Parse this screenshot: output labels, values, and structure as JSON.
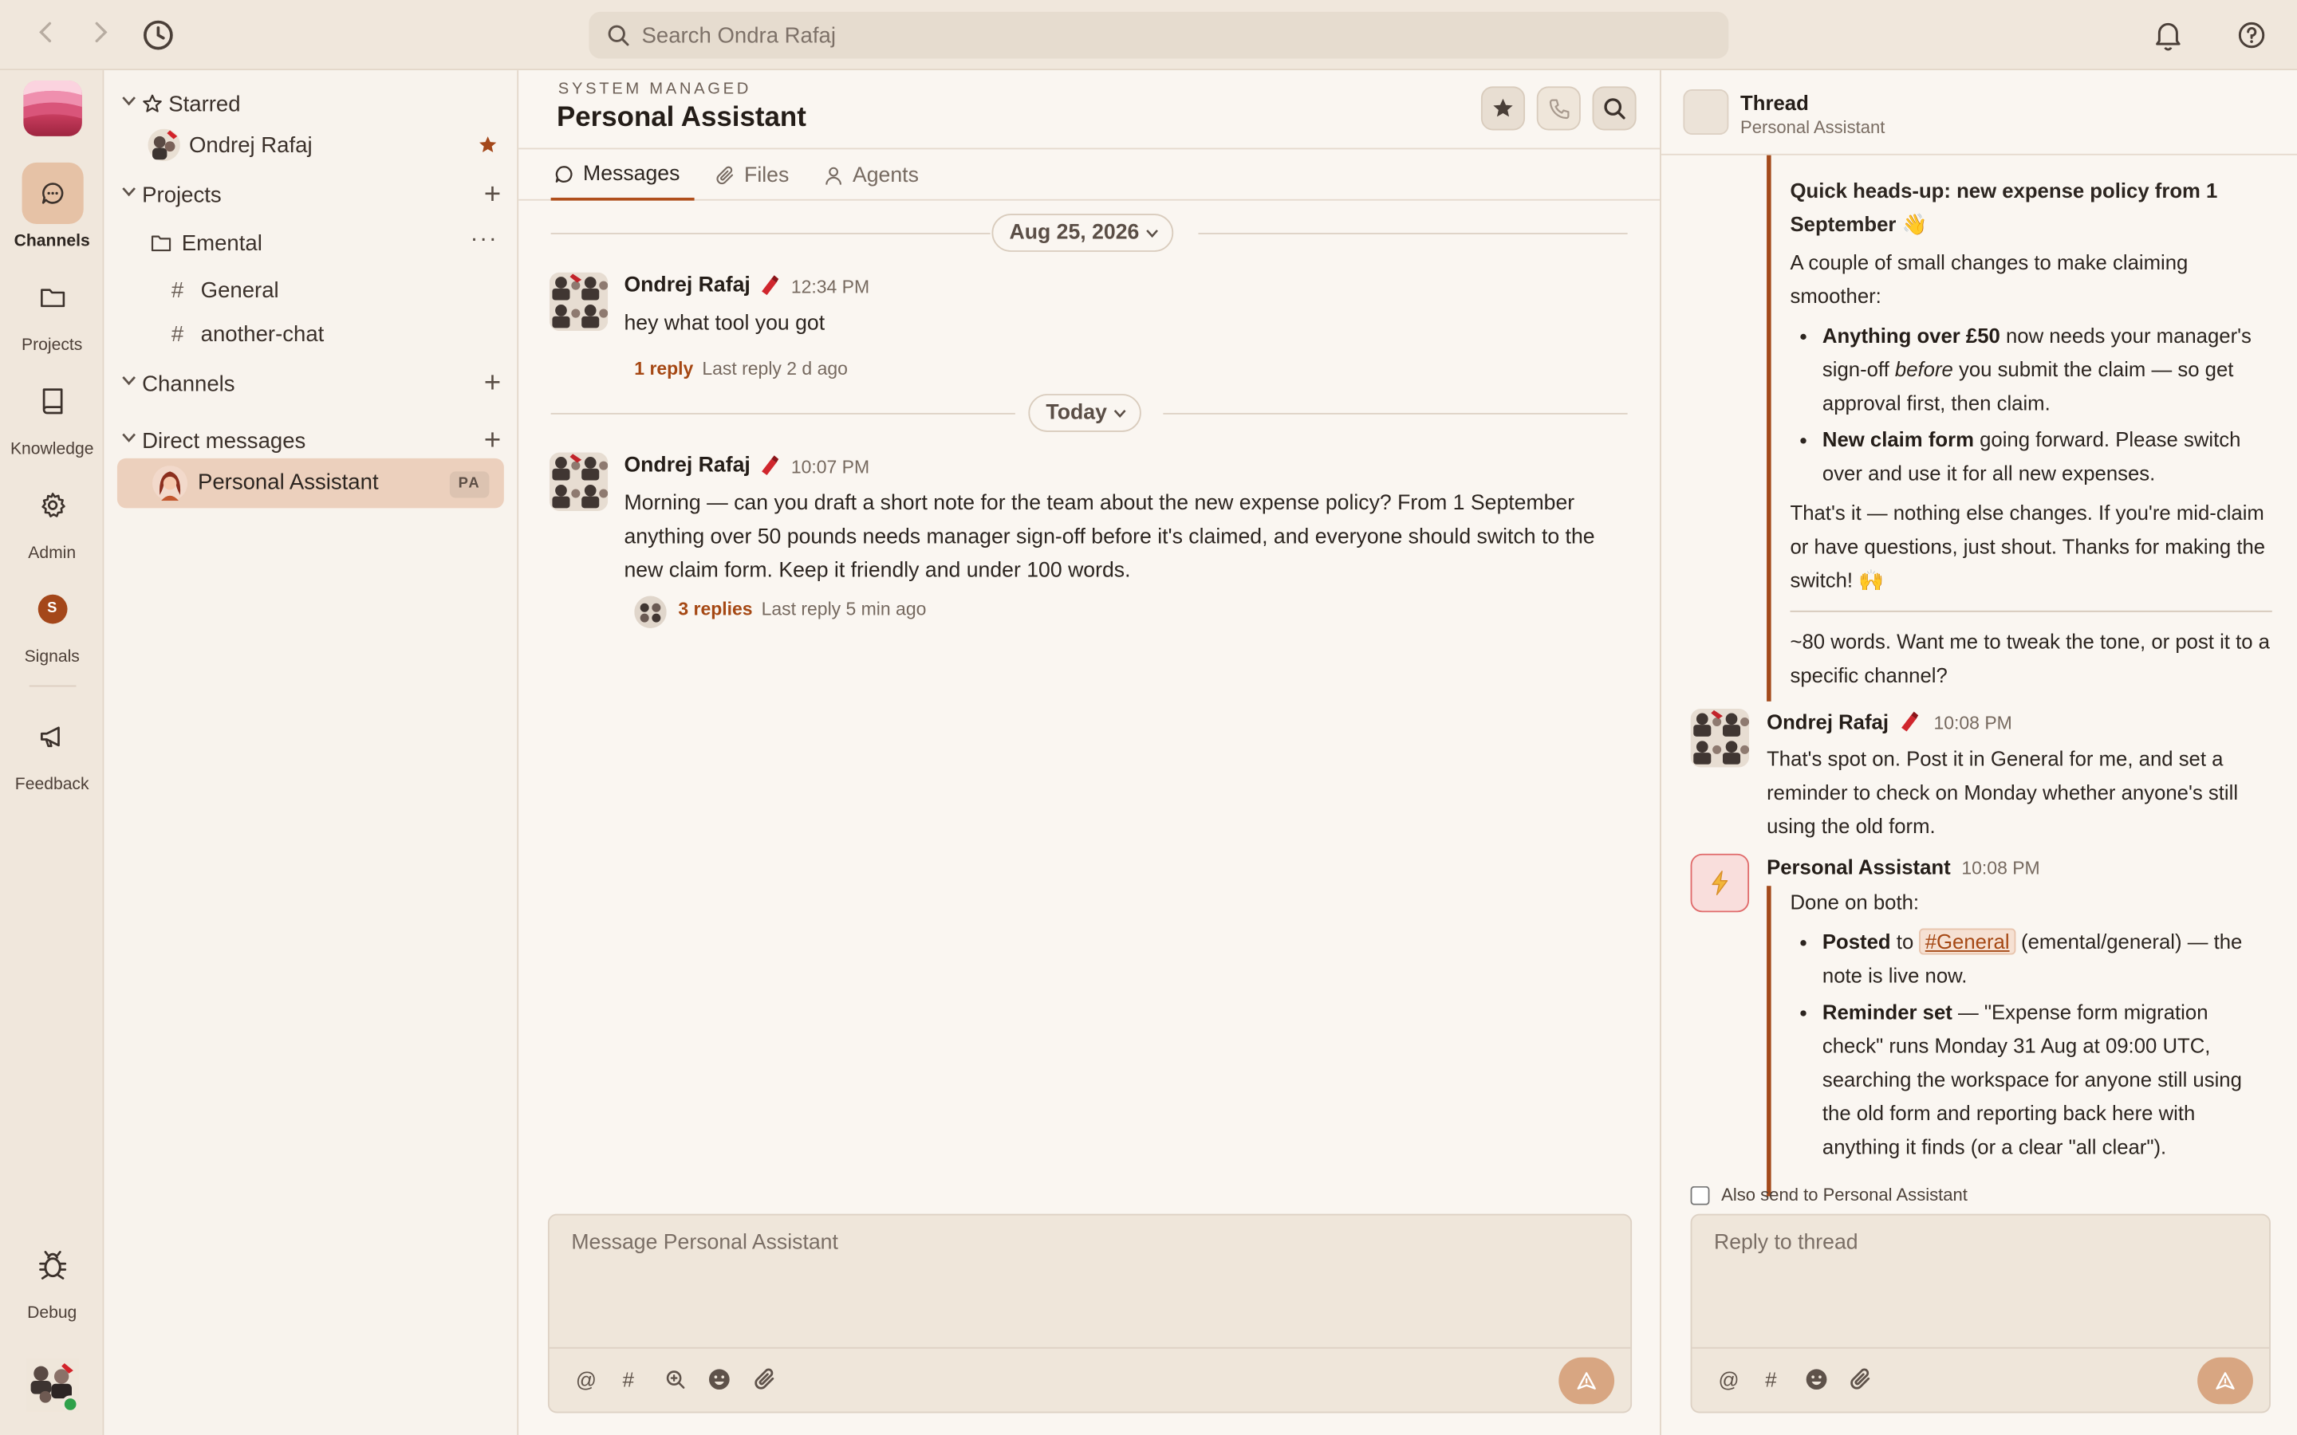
{
  "topbar": {
    "search_placeholder": "Search Ondra Rafaj"
  },
  "rail": {
    "items": [
      {
        "label": "Channels"
      },
      {
        "label": "Projects"
      },
      {
        "label": "Knowledge"
      },
      {
        "label": "Admin"
      },
      {
        "label": "Signals",
        "badge": "S"
      },
      {
        "label": "Feedback"
      },
      {
        "label": "Debug"
      }
    ]
  },
  "sidebar": {
    "starred": {
      "label": "Starred",
      "items": [
        {
          "label": "Ondrej Rafaj"
        }
      ]
    },
    "projects": {
      "label": "Projects",
      "folder": "Emental",
      "more": "···",
      "channels": [
        "General",
        "another-chat"
      ]
    },
    "channels": {
      "label": "Channels"
    },
    "direct": {
      "label": "Direct messages",
      "items": [
        {
          "label": "Personal Assistant",
          "badge": "PA"
        }
      ]
    },
    "plus": "+",
    "hash": "#"
  },
  "main": {
    "system_label": "SYSTEM MANAGED",
    "title": "Personal Assistant",
    "tabs": [
      {
        "label": "Messages"
      },
      {
        "label": "Files"
      },
      {
        "label": "Agents"
      }
    ],
    "dividers": [
      "Aug 25, 2026",
      "Today"
    ],
    "messages": [
      {
        "author": "Ondrej Rafaj",
        "time": "12:34 PM",
        "text": "hey what tool you got",
        "reply_count": "1 reply",
        "last_reply": "Last reply 2 d ago"
      },
      {
        "author": "Ondrej Rafaj",
        "time": "10:07 PM",
        "text": "Morning — can you draft a short note for the team about the new expense policy? From 1 September anything over 50 pounds needs manager sign-off before it's claimed, and everyone should switch to the new claim form. Keep it friendly and under 100 words.",
        "reply_count": "3 replies",
        "last_reply": "Last reply 5 min ago"
      }
    ],
    "composer_placeholder": "Message Personal Assistant",
    "tools": [
      "@",
      "#"
    ]
  },
  "thread": {
    "title": "Thread",
    "subtitle": "Personal Assistant",
    "quote": {
      "heading": "Quick heads-up: new expense policy from 1 September 👋",
      "intro": "A couple of small changes to make claiming smoother:",
      "b1_bold": "Anything over £50",
      "b1_pre": " now needs your manager's sign-off ",
      "b1_em": "before",
      "b1_post": " you submit the claim — so get approval first, then claim.",
      "b2_bold": "New claim form",
      "b2_rest": " going forward. Please switch over and use it for all new expenses.",
      "outro": "That's it — nothing else changes. If you're mid-claim or have questions, just shout. Thanks for making the switch! 🙌",
      "footer": "~80 words. Want me to tweak the tone, or post it to a specific channel?"
    },
    "reply1": {
      "author": "Ondrej Rafaj",
      "time": "10:08 PM",
      "text": "That's spot on. Post it in General for me, and set a reminder to check on Monday whether anyone's still using the old form."
    },
    "reply2": {
      "author": "Personal Assistant",
      "time": "10:08 PM",
      "intro": "Done on both:",
      "b1_bold": "Posted",
      "b1_to": " to ",
      "b1_chip": "#General",
      "b1_rest": " (emental/general) — the note is live now.",
      "b2_bold": "Reminder set",
      "b2_rest": " — \"Expense form migration check\" runs Monday 31 Aug at 09:00 UTC, searching the workspace for anyone still using the old form and reporting back here with anything it finds (or a clear \"all clear\")."
    },
    "also_send": "Also send to Personal Assistant",
    "composer_placeholder": "Reply to thread"
  }
}
